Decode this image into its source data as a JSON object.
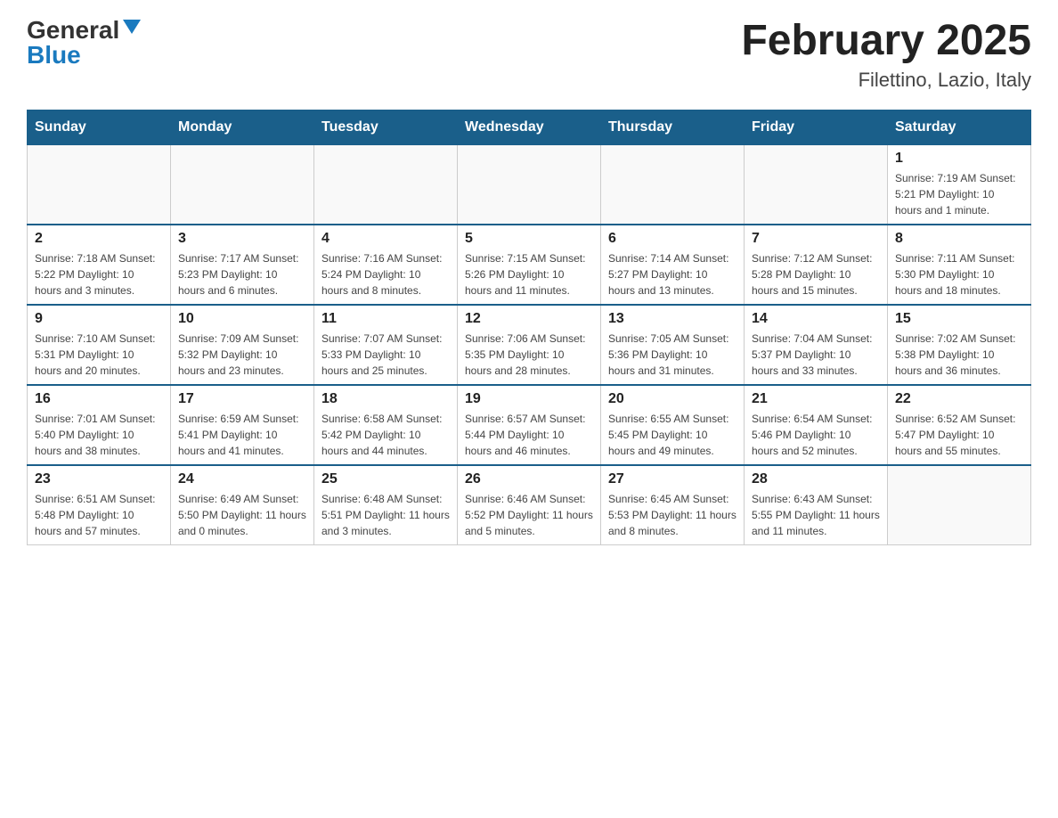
{
  "logo": {
    "general": "General",
    "blue": "Blue"
  },
  "title": "February 2025",
  "subtitle": "Filettino, Lazio, Italy",
  "weekdays": [
    "Sunday",
    "Monday",
    "Tuesday",
    "Wednesday",
    "Thursday",
    "Friday",
    "Saturday"
  ],
  "weeks": [
    [
      {
        "day": "",
        "info": ""
      },
      {
        "day": "",
        "info": ""
      },
      {
        "day": "",
        "info": ""
      },
      {
        "day": "",
        "info": ""
      },
      {
        "day": "",
        "info": ""
      },
      {
        "day": "",
        "info": ""
      },
      {
        "day": "1",
        "info": "Sunrise: 7:19 AM\nSunset: 5:21 PM\nDaylight: 10 hours and 1 minute."
      }
    ],
    [
      {
        "day": "2",
        "info": "Sunrise: 7:18 AM\nSunset: 5:22 PM\nDaylight: 10 hours and 3 minutes."
      },
      {
        "day": "3",
        "info": "Sunrise: 7:17 AM\nSunset: 5:23 PM\nDaylight: 10 hours and 6 minutes."
      },
      {
        "day": "4",
        "info": "Sunrise: 7:16 AM\nSunset: 5:24 PM\nDaylight: 10 hours and 8 minutes."
      },
      {
        "day": "5",
        "info": "Sunrise: 7:15 AM\nSunset: 5:26 PM\nDaylight: 10 hours and 11 minutes."
      },
      {
        "day": "6",
        "info": "Sunrise: 7:14 AM\nSunset: 5:27 PM\nDaylight: 10 hours and 13 minutes."
      },
      {
        "day": "7",
        "info": "Sunrise: 7:12 AM\nSunset: 5:28 PM\nDaylight: 10 hours and 15 minutes."
      },
      {
        "day": "8",
        "info": "Sunrise: 7:11 AM\nSunset: 5:30 PM\nDaylight: 10 hours and 18 minutes."
      }
    ],
    [
      {
        "day": "9",
        "info": "Sunrise: 7:10 AM\nSunset: 5:31 PM\nDaylight: 10 hours and 20 minutes."
      },
      {
        "day": "10",
        "info": "Sunrise: 7:09 AM\nSunset: 5:32 PM\nDaylight: 10 hours and 23 minutes."
      },
      {
        "day": "11",
        "info": "Sunrise: 7:07 AM\nSunset: 5:33 PM\nDaylight: 10 hours and 25 minutes."
      },
      {
        "day": "12",
        "info": "Sunrise: 7:06 AM\nSunset: 5:35 PM\nDaylight: 10 hours and 28 minutes."
      },
      {
        "day": "13",
        "info": "Sunrise: 7:05 AM\nSunset: 5:36 PM\nDaylight: 10 hours and 31 minutes."
      },
      {
        "day": "14",
        "info": "Sunrise: 7:04 AM\nSunset: 5:37 PM\nDaylight: 10 hours and 33 minutes."
      },
      {
        "day": "15",
        "info": "Sunrise: 7:02 AM\nSunset: 5:38 PM\nDaylight: 10 hours and 36 minutes."
      }
    ],
    [
      {
        "day": "16",
        "info": "Sunrise: 7:01 AM\nSunset: 5:40 PM\nDaylight: 10 hours and 38 minutes."
      },
      {
        "day": "17",
        "info": "Sunrise: 6:59 AM\nSunset: 5:41 PM\nDaylight: 10 hours and 41 minutes."
      },
      {
        "day": "18",
        "info": "Sunrise: 6:58 AM\nSunset: 5:42 PM\nDaylight: 10 hours and 44 minutes."
      },
      {
        "day": "19",
        "info": "Sunrise: 6:57 AM\nSunset: 5:44 PM\nDaylight: 10 hours and 46 minutes."
      },
      {
        "day": "20",
        "info": "Sunrise: 6:55 AM\nSunset: 5:45 PM\nDaylight: 10 hours and 49 minutes."
      },
      {
        "day": "21",
        "info": "Sunrise: 6:54 AM\nSunset: 5:46 PM\nDaylight: 10 hours and 52 minutes."
      },
      {
        "day": "22",
        "info": "Sunrise: 6:52 AM\nSunset: 5:47 PM\nDaylight: 10 hours and 55 minutes."
      }
    ],
    [
      {
        "day": "23",
        "info": "Sunrise: 6:51 AM\nSunset: 5:48 PM\nDaylight: 10 hours and 57 minutes."
      },
      {
        "day": "24",
        "info": "Sunrise: 6:49 AM\nSunset: 5:50 PM\nDaylight: 11 hours and 0 minutes."
      },
      {
        "day": "25",
        "info": "Sunrise: 6:48 AM\nSunset: 5:51 PM\nDaylight: 11 hours and 3 minutes."
      },
      {
        "day": "26",
        "info": "Sunrise: 6:46 AM\nSunset: 5:52 PM\nDaylight: 11 hours and 5 minutes."
      },
      {
        "day": "27",
        "info": "Sunrise: 6:45 AM\nSunset: 5:53 PM\nDaylight: 11 hours and 8 minutes."
      },
      {
        "day": "28",
        "info": "Sunrise: 6:43 AM\nSunset: 5:55 PM\nDaylight: 11 hours and 11 minutes."
      },
      {
        "day": "",
        "info": ""
      }
    ]
  ]
}
